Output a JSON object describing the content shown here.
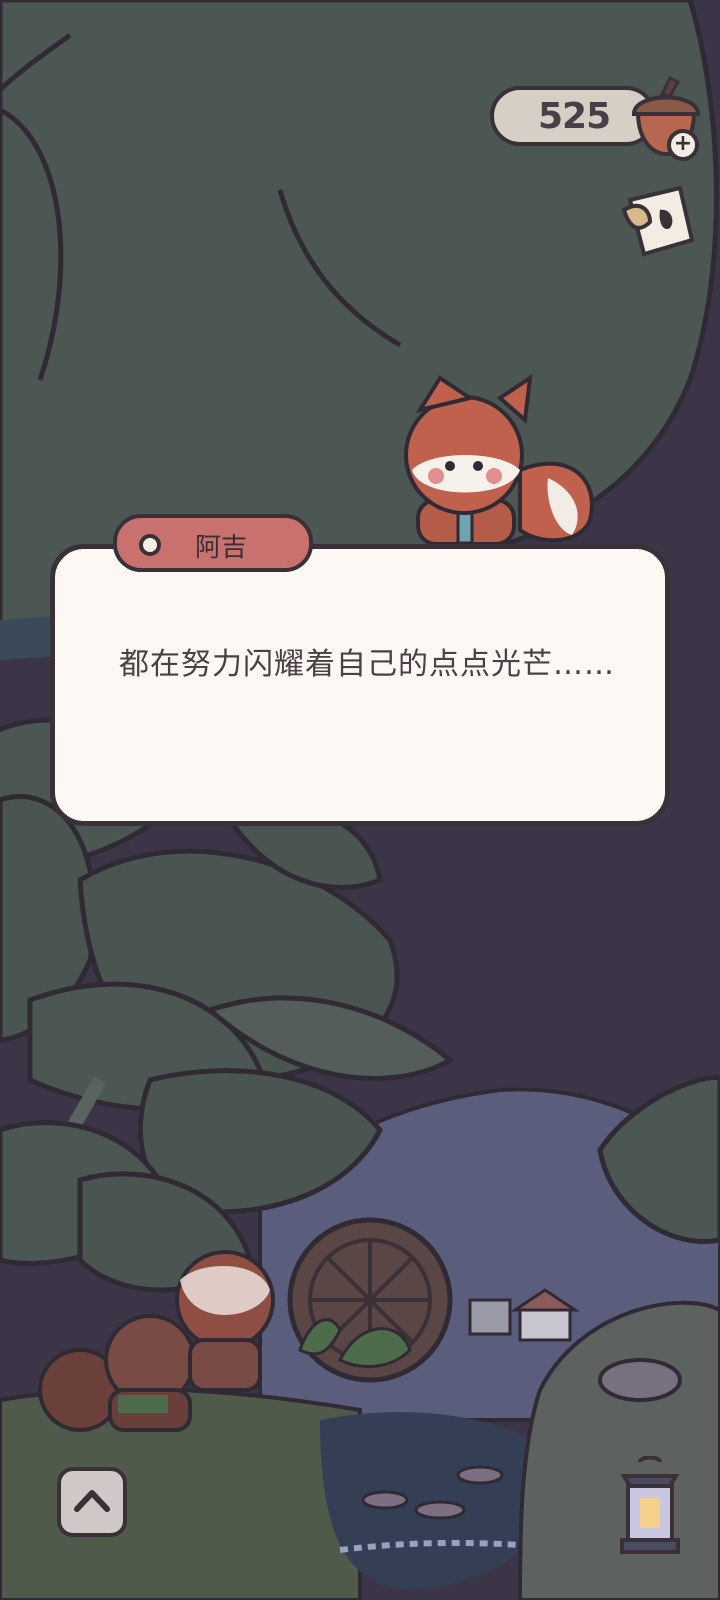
{
  "hud": {
    "currency_value": "525",
    "currency_icon": "acorn-icon",
    "add_icon_glyph": "+",
    "journal_icon": "journal-icon"
  },
  "dialogue": {
    "speaker": "阿吉",
    "text": "都在努力闪耀着自己的点点光芒……"
  },
  "controls": {
    "expand_icon": "chevron-up-icon"
  },
  "colors": {
    "night_sky": "#3b3547",
    "tree_canopy": "#4c5652",
    "name_tag": "#c8716f",
    "dialog_bg": "#fcf8f3",
    "outline": "#3a3038"
  }
}
